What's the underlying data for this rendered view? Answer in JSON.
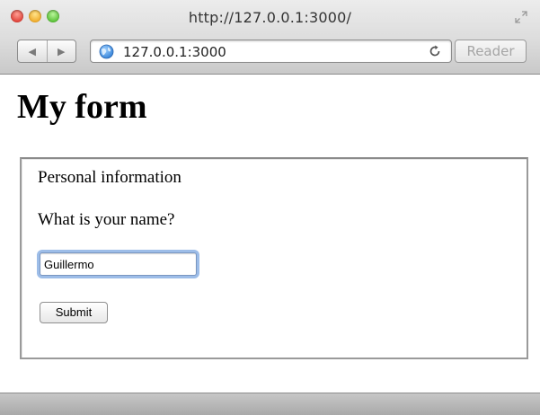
{
  "window": {
    "title": "http://127.0.0.1:3000/"
  },
  "toolbar": {
    "address": "127.0.0.1:3000",
    "reader_label": "Reader",
    "back_glyph": "◀",
    "forward_glyph": "▶"
  },
  "page": {
    "heading": "My form",
    "fieldset": {
      "legend": "Personal information",
      "question": "What is your name?",
      "name_value": "Guillermo",
      "submit_label": "Submit"
    }
  },
  "icons": {
    "close": "close-traffic-light",
    "minimize": "minimize-traffic-light",
    "zoom": "zoom-traffic-light",
    "fullscreen": "fullscreen-icon",
    "globe": "globe-icon",
    "reload": "reload-icon"
  },
  "colors": {
    "focus_ring": "#9dbde8",
    "globe_blue": "#2f7fd6"
  }
}
